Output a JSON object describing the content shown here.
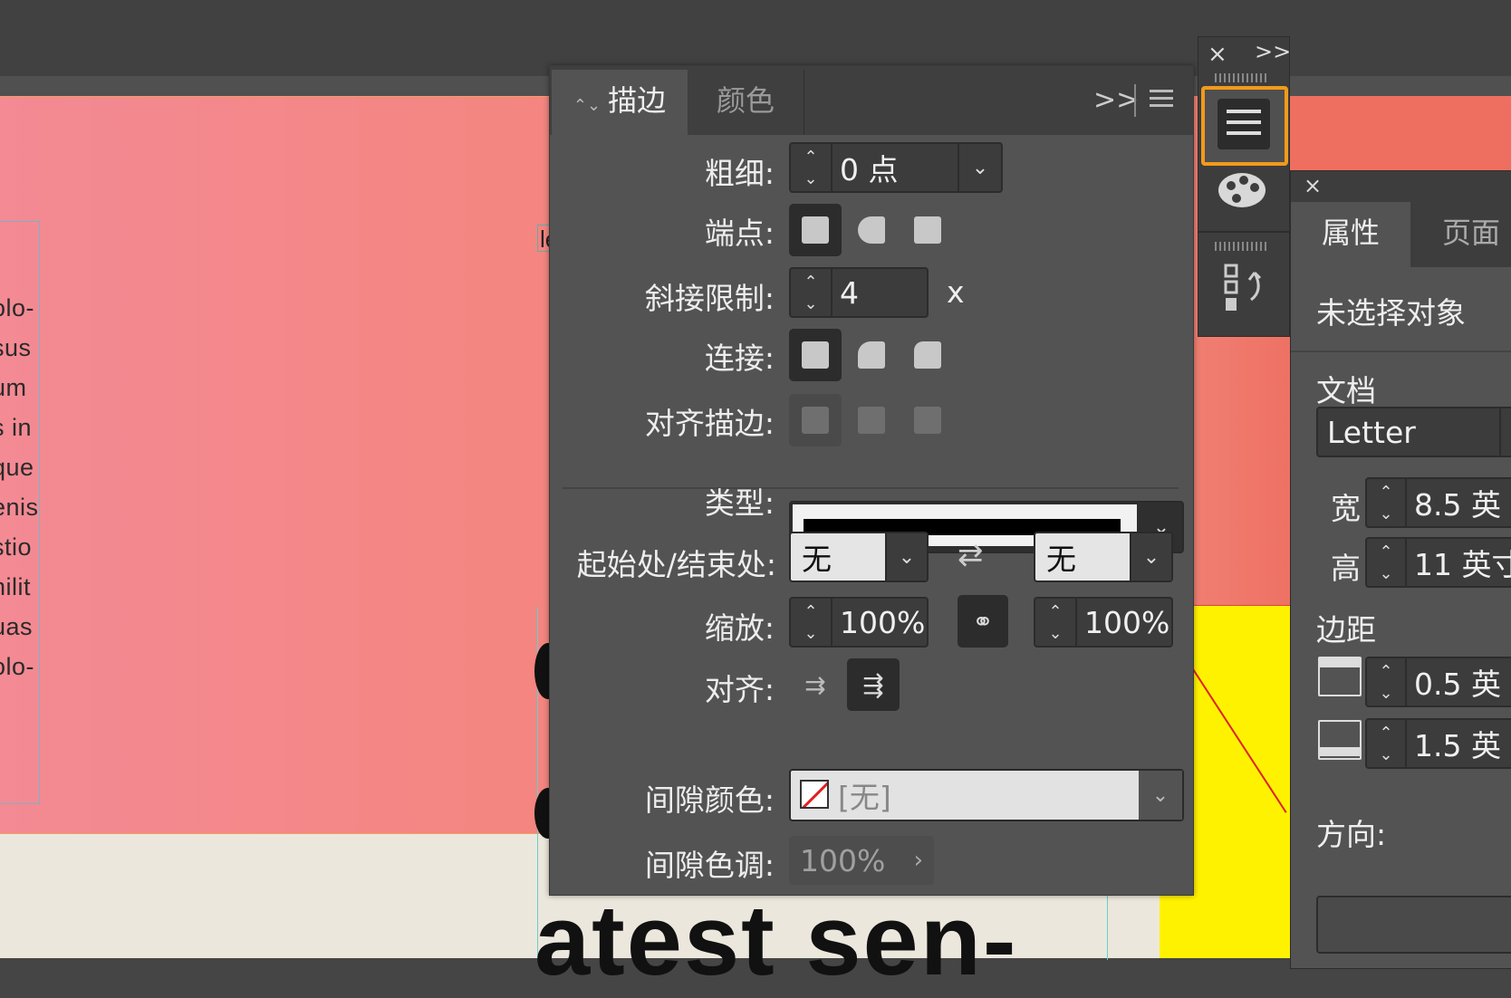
{
  "canvas": {
    "left_text_fragments": [
      "olo-",
      "sus",
      "um",
      "s in",
      "que",
      "enis",
      "stio",
      "nilit",
      "uas",
      "olo-"
    ],
    "headline_fragment": "atest sen-",
    "selection_char": "le"
  },
  "stroke_panel": {
    "tabs": [
      {
        "label": "描边",
        "active": true
      },
      {
        "label": "颜色",
        "active": false
      }
    ],
    "expand_icon": ">>",
    "weight": {
      "label": "粗细:",
      "value": "0 点"
    },
    "cap": {
      "label": "端点:"
    },
    "miter_limit": {
      "label": "斜接限制:",
      "value": "4",
      "suffix": "x"
    },
    "join": {
      "label": "连接:"
    },
    "align_stroke": {
      "label": "对齐描边:"
    },
    "type": {
      "label": "类型:"
    },
    "start_end": {
      "label": "起始处/结束处:",
      "start_value": "无",
      "end_value": "无"
    },
    "scale": {
      "label": "缩放:",
      "start_value": "100%",
      "end_value": "100%"
    },
    "align": {
      "label": "对齐:"
    },
    "gap_color": {
      "label": "间隙颜色:",
      "value": "[无]"
    },
    "gap_tint": {
      "label": "间隙色调:",
      "value": "100%"
    }
  },
  "dock": {
    "close_icon": "×",
    "expand_icon": ">>",
    "highlight_color": "#f29a1a"
  },
  "properties_panel": {
    "close_icon": "×",
    "tabs": [
      {
        "label": "属性",
        "active": true
      },
      {
        "label": "页面",
        "active": false
      }
    ],
    "no_selection": "未选择对象",
    "document_heading": "文档",
    "preset_value": "Letter",
    "width": {
      "label": "宽",
      "value": "8.5 英"
    },
    "height": {
      "label": "高",
      "value": "11 英寸"
    },
    "margins_heading": "边距",
    "margin_top_value": "0.5 英",
    "margin_bottom_value": "1.5 英",
    "orientation_label": "方向:"
  }
}
